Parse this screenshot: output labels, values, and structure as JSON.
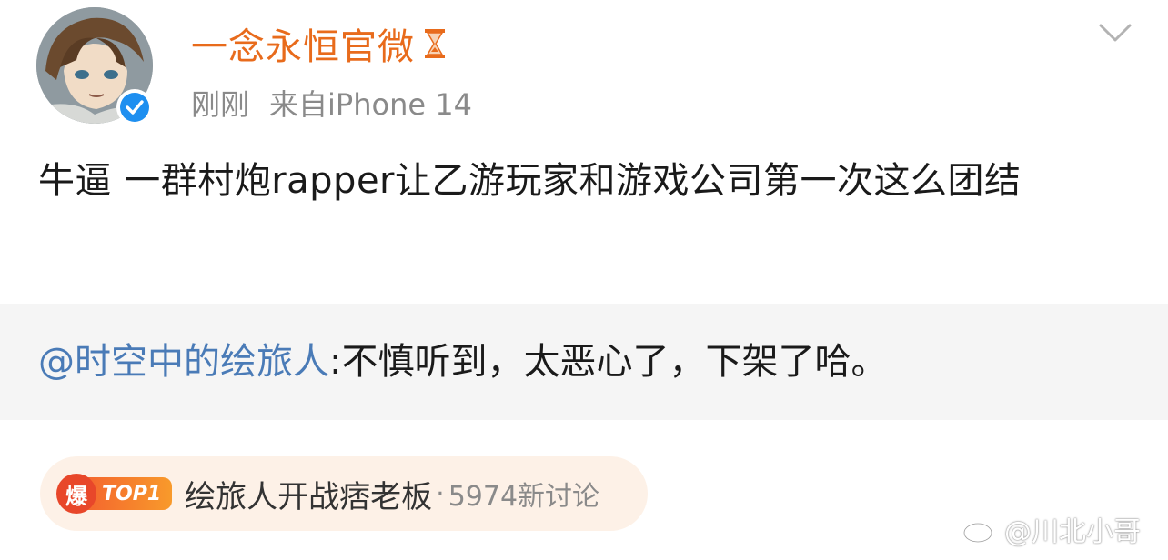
{
  "post": {
    "username": "一念永恒官微",
    "timestamp": "刚刚",
    "source": "来自iPhone 14",
    "text": "牛逼 一群村炮rapper让乙游玩家和游戏公司第一次这么团结"
  },
  "quoted": {
    "mention": "@时空中的绘旅人",
    "text": ":不慎听到，太恶心了，下架了哈。"
  },
  "trend": {
    "hot_badge": "爆",
    "rank_badge": "TOP1",
    "title": "绘旅人开战痞老板",
    "separator": "·",
    "count": "5974新讨论"
  },
  "watermark": {
    "text": "@川北小哥"
  },
  "icons": {
    "verified": "verified-badge-icon",
    "hourglass": "hourglass-icon",
    "menu": "chevron-down-icon",
    "weibo": "weibo-logo-icon"
  },
  "colors": {
    "username": "#e86b1c",
    "mention": "#4a7bb7",
    "meta": "#8a8a8a",
    "verified": "#1e8ff0",
    "hot": "#e8472a"
  }
}
